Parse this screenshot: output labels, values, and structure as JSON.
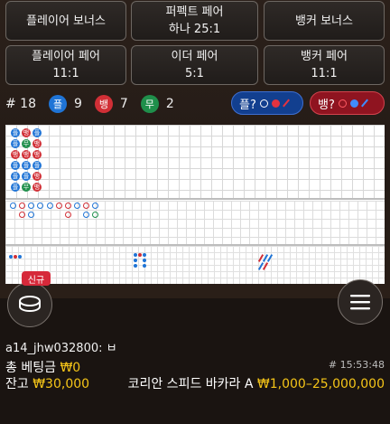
{
  "bets": {
    "player_bonus": {
      "label": "플레이어 보너스"
    },
    "perfect_pair": {
      "label": "퍼펙트 페어",
      "odds": "하나 25:1"
    },
    "banker_bonus": {
      "label": "뱅커 보너스"
    },
    "player_pair": {
      "label": "플레이어 페어",
      "odds": "11:1"
    },
    "either_pair": {
      "label": "이더 페어",
      "odds": "5:1"
    },
    "banker_pair": {
      "label": "뱅커 페어",
      "odds": "11:1"
    }
  },
  "stats": {
    "round": "# 18",
    "player_icon": "플",
    "player_count": "9",
    "banker_icon": "뱅",
    "banker_count": "7",
    "tie_icon": "무",
    "tie_count": "2"
  },
  "ask": {
    "player": "플?",
    "banker": "뱅?"
  },
  "colors": {
    "player": "#1f74d6",
    "banker": "#d12f36",
    "tie": "#1f8f4b",
    "gold": "#f5c518"
  },
  "bead_road": {
    "labels": {
      "P": "플",
      "B": "뱅",
      "T": "무"
    },
    "columns": [
      [
        "P",
        "P",
        "B",
        "P",
        "P",
        "P"
      ],
      [
        "B",
        "T",
        "B",
        "P",
        "P",
        "T"
      ],
      [
        "P",
        "B",
        "B",
        "P",
        "B",
        "B"
      ]
    ]
  },
  "menu": {
    "new_label": "신규",
    "chip_icon": "chip-stack-icon",
    "menu_icon": "hamburger-menu-icon"
  },
  "user": {
    "name": "a14_jhw032800: ㅂ"
  },
  "footer": {
    "total_bet_label": "총 베팅금",
    "total_bet_value": "₩0",
    "balance_label": "잔고",
    "balance_value": "₩30,000",
    "round_time": "# 15:53:48",
    "table_name": "코리안 스피드 바카라 A",
    "limits": "₩1,000–25,000,000"
  }
}
